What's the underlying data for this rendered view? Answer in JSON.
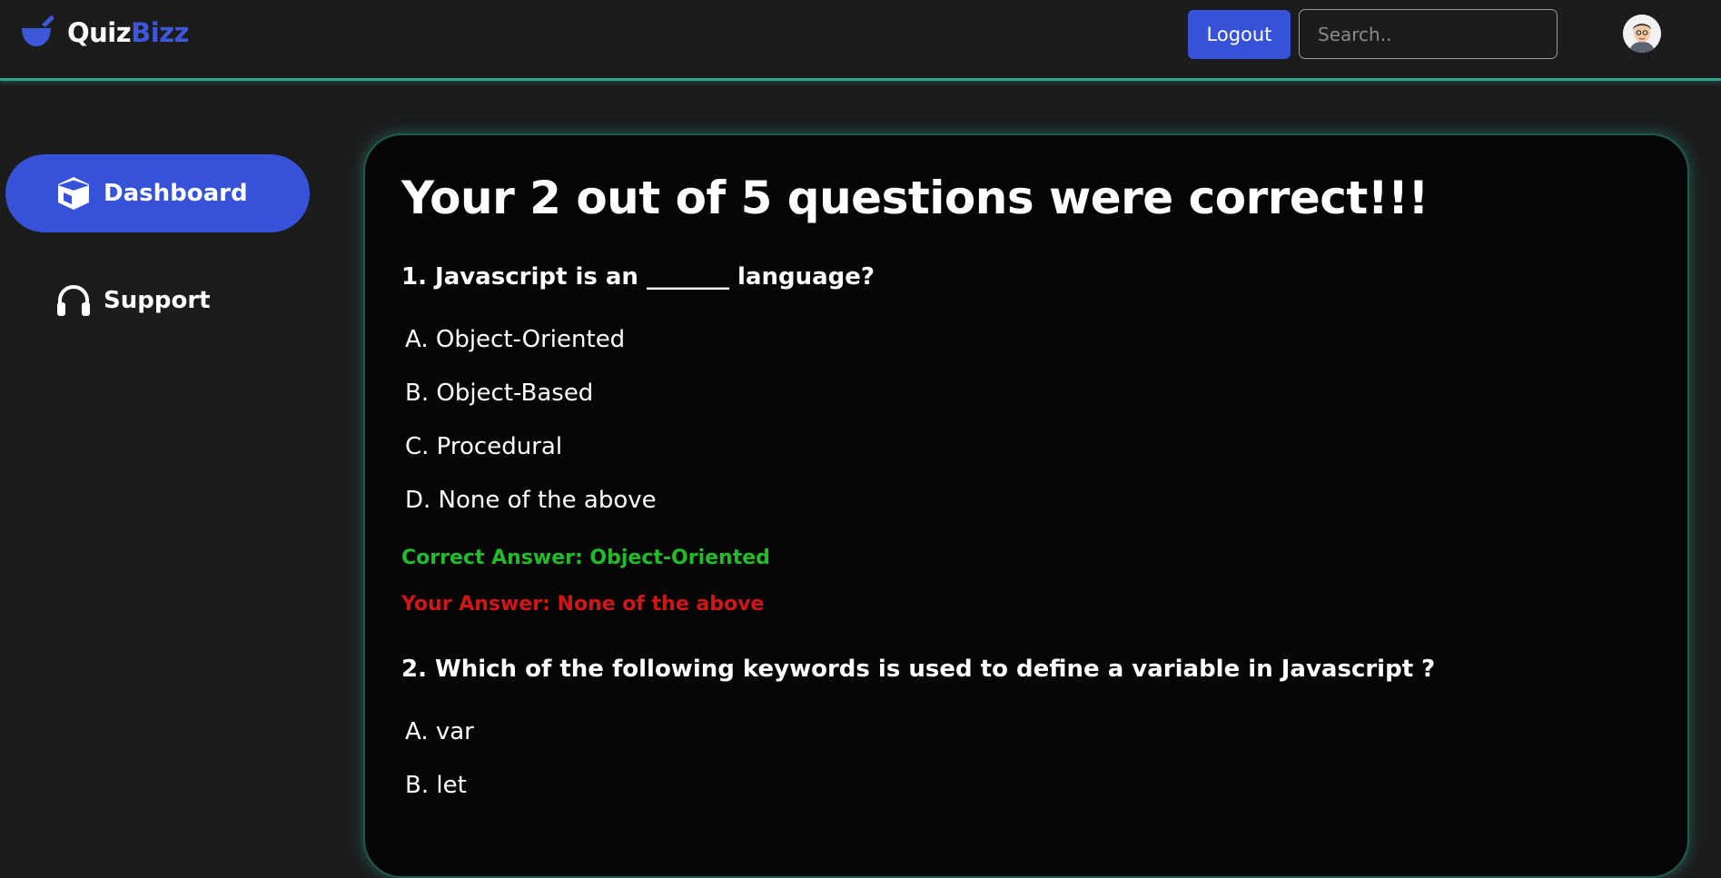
{
  "header": {
    "logo_part1": "Quiz",
    "logo_part2": "Bizz",
    "logout_label": "Logout",
    "search_placeholder": "Search..",
    "colors": {
      "accent": "#3652d9",
      "border_glow": "#2aa58e"
    }
  },
  "sidebar": {
    "items": [
      {
        "label": "Dashboard",
        "icon": "cube-icon",
        "active": true
      },
      {
        "label": "Support",
        "icon": "headphones-icon",
        "active": false
      }
    ]
  },
  "results": {
    "headline": "Your 2 out of 5 questions were correct!!!",
    "questions": [
      {
        "title": "1. Javascript is an _______ language?",
        "options": [
          "A. Object-Oriented",
          "B. Object-Based",
          "C. Procedural",
          "D. None of the above"
        ],
        "correct_answer": "Correct Answer: Object-Oriented",
        "your_answer": "Your Answer: None of the above"
      },
      {
        "title": "2. Which of the following keywords is used to define a variable in Javascript ?",
        "options": [
          "A. var",
          "B. let"
        ]
      }
    ],
    "colors": {
      "correct": "#22bb2a",
      "wrong": "#d01616"
    }
  }
}
